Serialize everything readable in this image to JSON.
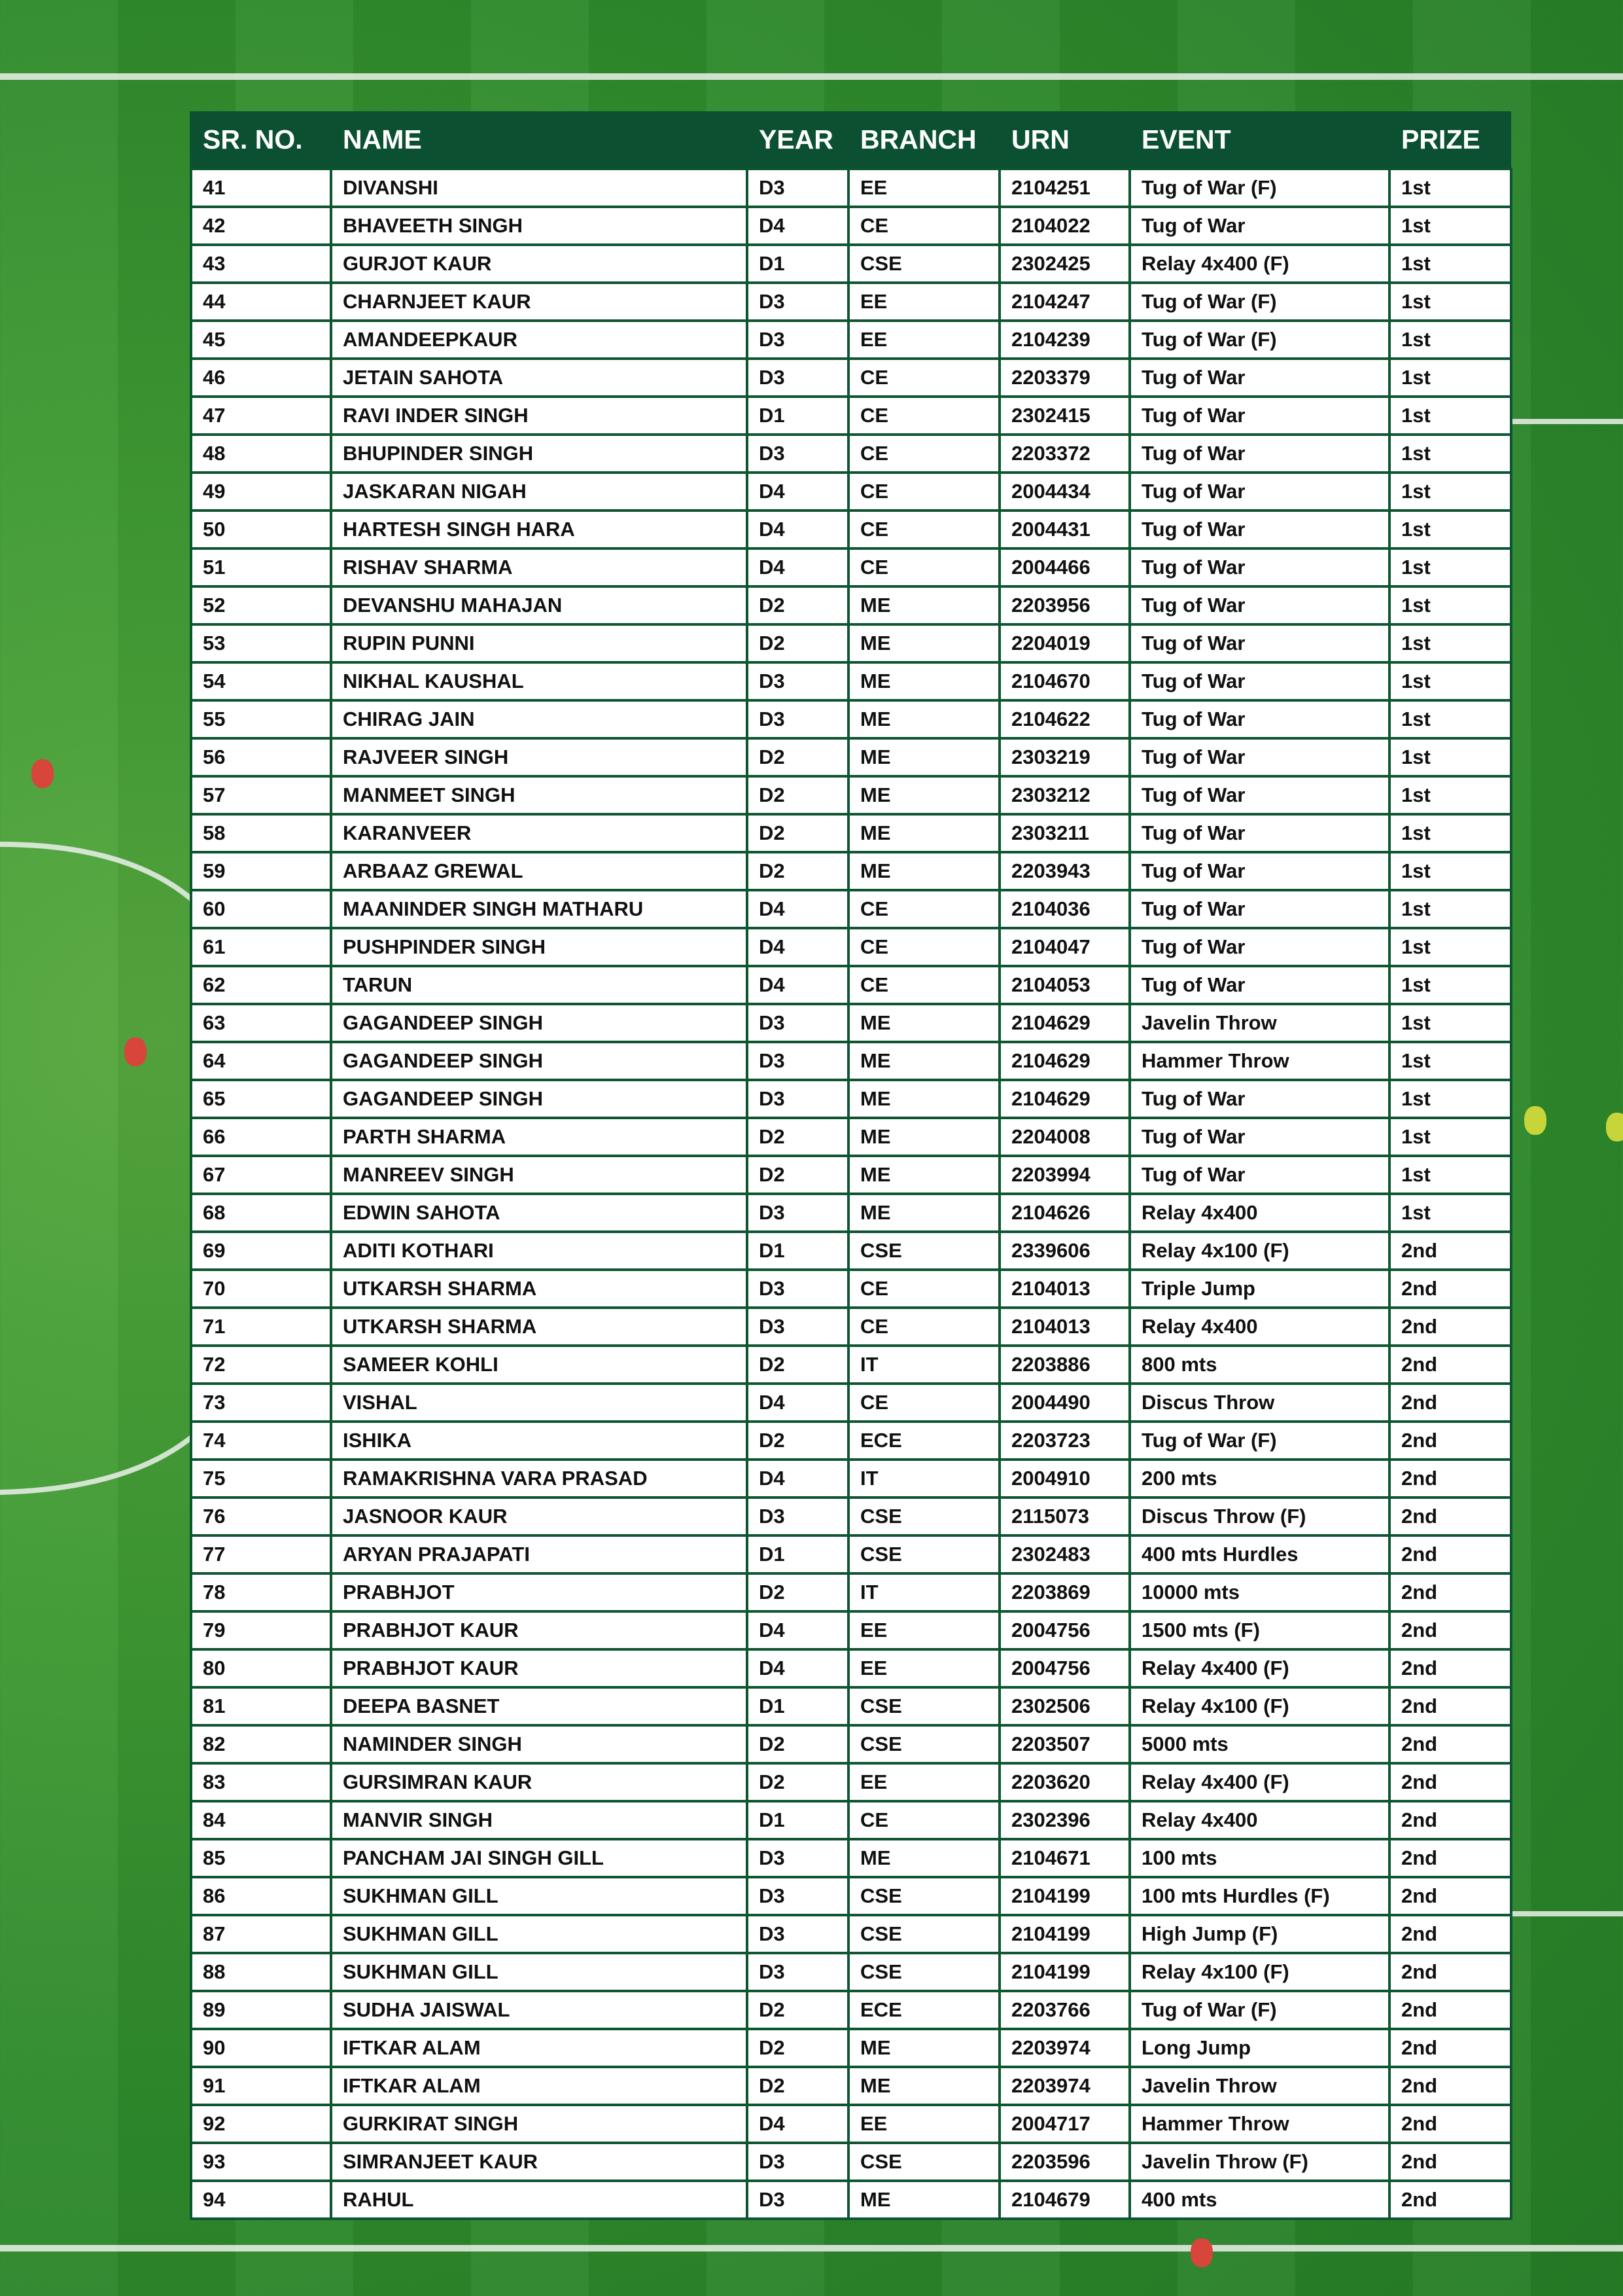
{
  "table": {
    "headers": [
      "SR. NO.",
      "NAME",
      "YEAR",
      "BRANCH",
      "URN",
      "EVENT",
      "PRIZE"
    ],
    "rows": [
      [
        "41",
        "DIVANSHI",
        "D3",
        "EE",
        "2104251",
        "Tug of War (F)",
        "1st"
      ],
      [
        "42",
        "BHAVEETH SINGH",
        "D4",
        "CE",
        "2104022",
        "Tug of War",
        "1st"
      ],
      [
        "43",
        "GURJOT KAUR",
        "D1",
        "CSE",
        "2302425",
        "Relay 4x400 (F)",
        "1st"
      ],
      [
        "44",
        "CHARNJEET KAUR",
        "D3",
        "EE",
        "2104247",
        "Tug of War (F)",
        "1st"
      ],
      [
        "45",
        "AMANDEEPKAUR",
        "D3",
        "EE",
        "2104239",
        "Tug of War (F)",
        "1st"
      ],
      [
        "46",
        "JETAIN SAHOTA",
        "D3",
        "CE",
        "2203379",
        "Tug of War",
        "1st"
      ],
      [
        "47",
        "RAVI INDER SINGH",
        "D1",
        "CE",
        "2302415",
        "Tug of War",
        "1st"
      ],
      [
        "48",
        "BHUPINDER SINGH",
        "D3",
        "CE",
        "2203372",
        "Tug of War",
        "1st"
      ],
      [
        "49",
        "JASKARAN NIGAH",
        "D4",
        "CE",
        "2004434",
        "Tug of War",
        "1st"
      ],
      [
        "50",
        "HARTESH SINGH HARA",
        "D4",
        "CE",
        "2004431",
        "Tug of War",
        "1st"
      ],
      [
        "51",
        "RISHAV SHARMA",
        "D4",
        "CE",
        "2004466",
        "Tug of War",
        "1st"
      ],
      [
        "52",
        "DEVANSHU MAHAJAN",
        "D2",
        "ME",
        "2203956",
        "Tug of War",
        "1st"
      ],
      [
        "53",
        "RUPIN PUNNI",
        "D2",
        "ME",
        "2204019",
        "Tug of War",
        "1st"
      ],
      [
        "54",
        "NIKHAL KAUSHAL",
        "D3",
        "ME",
        "2104670",
        "Tug of War",
        "1st"
      ],
      [
        "55",
        "CHIRAG JAIN",
        "D3",
        "ME",
        "2104622",
        "Tug of War",
        "1st"
      ],
      [
        "56",
        "RAJVEER SINGH",
        "D2",
        "ME",
        "2303219",
        "Tug of War",
        "1st"
      ],
      [
        "57",
        "MANMEET SINGH",
        "D2",
        "ME",
        "2303212",
        "Tug of War",
        "1st"
      ],
      [
        "58",
        "KARANVEER",
        "D2",
        "ME",
        "2303211",
        "Tug of War",
        "1st"
      ],
      [
        "59",
        "ARBAAZ GREWAL",
        "D2",
        "ME",
        "2203943",
        "Tug of War",
        "1st"
      ],
      [
        "60",
        "MAANINDER SINGH MATHARU",
        "D4",
        "CE",
        "2104036",
        "Tug of War",
        "1st"
      ],
      [
        "61",
        "PUSHPINDER SINGH",
        "D4",
        "CE",
        "2104047",
        "Tug of War",
        "1st"
      ],
      [
        "62",
        "TARUN",
        "D4",
        "CE",
        "2104053",
        "Tug of War",
        "1st"
      ],
      [
        "63",
        "GAGANDEEP SINGH",
        "D3",
        "ME",
        "2104629",
        "Javelin Throw",
        "1st"
      ],
      [
        "64",
        "GAGANDEEP SINGH",
        "D3",
        "ME",
        "2104629",
        "Hammer Throw",
        "1st"
      ],
      [
        "65",
        "GAGANDEEP SINGH",
        "D3",
        "ME",
        "2104629",
        "Tug of War",
        "1st"
      ],
      [
        "66",
        "PARTH SHARMA",
        "D2",
        "ME",
        "2204008",
        "Tug of War",
        "1st"
      ],
      [
        "67",
        "MANREEV SINGH",
        "D2",
        "ME",
        "2203994",
        "Tug of War",
        "1st"
      ],
      [
        "68",
        "EDWIN SAHOTA",
        "D3",
        "ME",
        "2104626",
        "Relay 4x400",
        "1st"
      ],
      [
        "69",
        "ADITI KOTHARI",
        "D1",
        "CSE",
        "2339606",
        "Relay 4x100 (F)",
        "2nd"
      ],
      [
        "70",
        "UTKARSH SHARMA",
        "D3",
        "CE",
        "2104013",
        "Triple Jump",
        "2nd"
      ],
      [
        "71",
        "UTKARSH SHARMA",
        "D3",
        "CE",
        "2104013",
        "Relay 4x400",
        "2nd"
      ],
      [
        "72",
        "SAMEER KOHLI",
        "D2",
        "IT",
        "2203886",
        "800 mts",
        "2nd"
      ],
      [
        "73",
        "VISHAL",
        "D4",
        "CE",
        "2004490",
        "Discus Throw",
        "2nd"
      ],
      [
        "74",
        "ISHIKA",
        "D2",
        "ECE",
        "2203723",
        "Tug of War (F)",
        "2nd"
      ],
      [
        "75",
        "RAMAKRISHNA VARA PRASAD",
        "D4",
        "IT",
        "2004910",
        "200 mts",
        "2nd"
      ],
      [
        "76",
        "JASNOOR KAUR",
        "D3",
        "CSE",
        "2115073",
        "Discus Throw (F)",
        "2nd"
      ],
      [
        "77",
        "ARYAN PRAJAPATI",
        "D1",
        "CSE",
        "2302483",
        "400 mts Hurdles",
        "2nd"
      ],
      [
        "78",
        "PRABHJOT",
        "D2",
        "IT",
        "2203869",
        "10000 mts",
        "2nd"
      ],
      [
        "79",
        "PRABHJOT KAUR",
        "D4",
        "EE",
        "2004756",
        "1500 mts (F)",
        "2nd"
      ],
      [
        "80",
        "PRABHJOT KAUR",
        "D4",
        "EE",
        "2004756",
        "Relay 4x400 (F)",
        "2nd"
      ],
      [
        "81",
        "DEEPA BASNET",
        "D1",
        "CSE",
        "2302506",
        "Relay 4x100 (F)",
        "2nd"
      ],
      [
        "82",
        "NAMINDER SINGH",
        "D2",
        "CSE",
        "2203507",
        "5000 mts",
        "2nd"
      ],
      [
        "83",
        "GURSIMRAN KAUR",
        "D2",
        "EE",
        "2203620",
        "Relay 4x400 (F)",
        "2nd"
      ],
      [
        "84",
        "MANVIR SINGH",
        "D1",
        "CE",
        "2302396",
        "Relay 4x400",
        "2nd"
      ],
      [
        "85",
        "PANCHAM JAI SINGH GILL",
        "D3",
        "ME",
        "2104671",
        "100 mts",
        "2nd"
      ],
      [
        "86",
        "SUKHMAN GILL",
        "D3",
        "CSE",
        "2104199",
        "100 mts Hurdles (F)",
        "2nd"
      ],
      [
        "87",
        "SUKHMAN GILL",
        "D3",
        "CSE",
        "2104199",
        "High Jump (F)",
        "2nd"
      ],
      [
        "88",
        "SUKHMAN GILL",
        "D3",
        "CSE",
        "2104199",
        "Relay 4x100 (F)",
        "2nd"
      ],
      [
        "89",
        "SUDHA JAISWAL",
        "D2",
        "ECE",
        "2203766",
        "Tug of War (F)",
        "2nd"
      ],
      [
        "90",
        "IFTKAR ALAM",
        "D2",
        "ME",
        "2203974",
        "Long Jump",
        "2nd"
      ],
      [
        "91",
        "IFTKAR ALAM",
        "D2",
        "ME",
        "2203974",
        "Javelin Throw",
        "2nd"
      ],
      [
        "92",
        "GURKIRAT SINGH",
        "D4",
        "EE",
        "2004717",
        "Hammer Throw",
        "2nd"
      ],
      [
        "93",
        "SIMRANJEET KAUR",
        "D3",
        "CSE",
        "2203596",
        "Javelin Throw (F)",
        "2nd"
      ],
      [
        "94",
        "RAHUL",
        "D3",
        "ME",
        "2104679",
        "400 mts",
        "2nd"
      ]
    ]
  }
}
